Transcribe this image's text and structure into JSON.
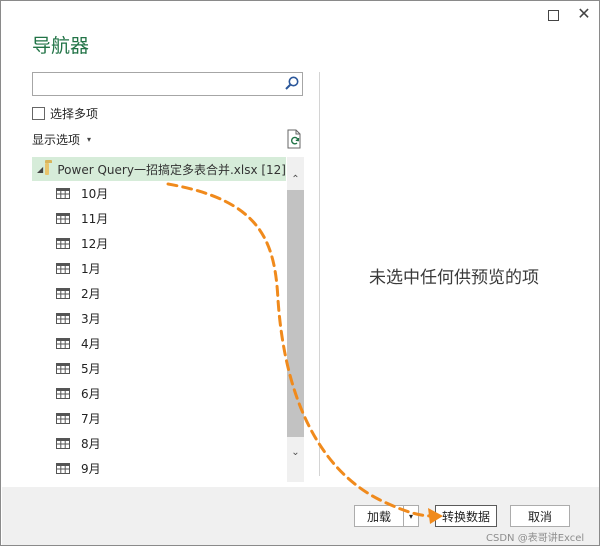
{
  "dialog": {
    "title": "导航器",
    "close_glyph": "✕"
  },
  "search": {
    "value": "",
    "placeholder": ""
  },
  "select_multiple_label": "选择多项",
  "display_options": {
    "label": "显示选项",
    "caret": "▾"
  },
  "tree": {
    "root": {
      "label": "Power Query一招搞定多表合并.xlsx [12]",
      "expanded_glyph": "◢"
    },
    "sheets": [
      "10月",
      "11月",
      "12月",
      "1月",
      "2月",
      "3月",
      "4月",
      "5月",
      "6月",
      "7月",
      "8月",
      "9月"
    ]
  },
  "scrollbar": {
    "up_glyph": "⌃",
    "down_glyph": "⌄"
  },
  "preview": {
    "empty_message": "未选中任何供预览的项"
  },
  "buttons": {
    "load": "加载",
    "load_dropdown": "▾",
    "transform": "转换数据",
    "cancel": "取消"
  },
  "watermark": "CSDN @表哥讲Excel",
  "colors": {
    "accent_green": "#217346",
    "selected_row": "#d6ecd9",
    "annotation_arrow": "#f08a1c"
  },
  "icons": [
    "maximize-icon",
    "close-icon",
    "search-icon",
    "refresh-icon",
    "folder-icon",
    "table-icon"
  ]
}
